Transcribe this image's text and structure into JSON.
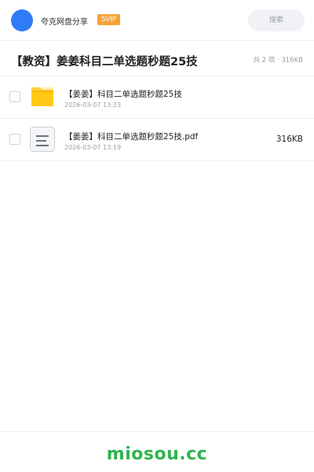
{
  "header": {
    "brand": "夸克网盘分享",
    "vip_badge": "SVIP",
    "search_label": "搜索",
    "colors": {
      "avatar": "#2f7cf6",
      "vip": "#f5a23a"
    }
  },
  "share": {
    "title": "【教资】姜姜科目二单选题秒题25技",
    "meta": "共 2 项 · 316KB"
  },
  "files": [
    {
      "name": "【姜姜】科目二单选题秒题25技",
      "date": "2026-03-07 13:23",
      "size": "",
      "icon": "folder-icon"
    },
    {
      "name": "【姜姜】科目二单选题秒题25技.pdf",
      "date": "2026-03-07 13:19",
      "size": "316KB",
      "icon": "document-icon"
    }
  ],
  "footer": {
    "logo": "miosou.cc",
    "color": "#2eb34d"
  }
}
